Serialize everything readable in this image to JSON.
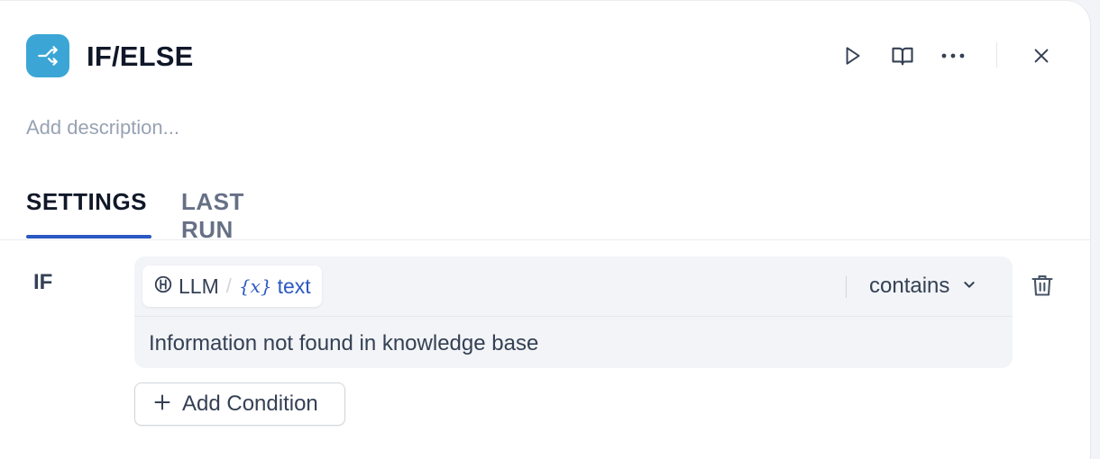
{
  "node": {
    "title": "IF/ELSE",
    "icon": "branch-icon",
    "icon_color": "#3ba6d6",
    "description_placeholder": "Add description..."
  },
  "header_actions": [
    {
      "name": "run-icon"
    },
    {
      "name": "docs-icon"
    },
    {
      "name": "more-icon"
    },
    {
      "name": "close-icon"
    }
  ],
  "tabs": [
    {
      "label": "SETTINGS",
      "active": true
    },
    {
      "label": "LAST RUN",
      "active": false
    }
  ],
  "condition": {
    "label": "IF",
    "variable": {
      "node_name": "LLM",
      "separator": "/",
      "var_icon": "{x}",
      "var_name": "text"
    },
    "operator": "contains",
    "value": "Information not found in knowledge base"
  },
  "add_condition_label": "Add Condition",
  "colors": {
    "accent": "#2b59c3",
    "text": "#101828",
    "muted": "#98a2b3"
  }
}
